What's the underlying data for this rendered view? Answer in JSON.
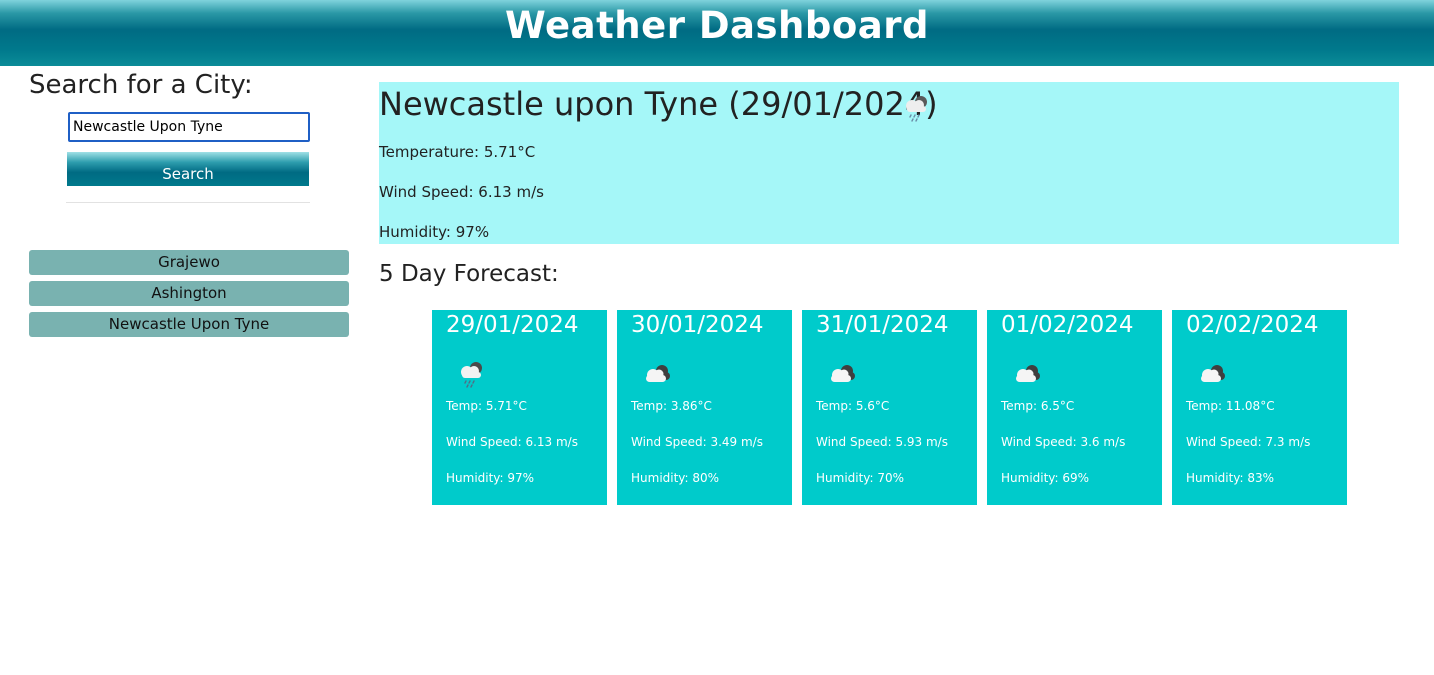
{
  "header": {
    "title": "Weather Dashboard"
  },
  "search": {
    "heading": "Search for a City:",
    "input_value": "Newcastle Upon Tyne",
    "button_label": "Search"
  },
  "history": [
    "Grajewo",
    "Ashington",
    "Newcastle Upon Tyne"
  ],
  "current": {
    "title": "Newcastle upon Tyne (29/01/2024)",
    "icon": "rain-cloud-icon",
    "temperature": "Temperature: 5.71°C",
    "wind": "Wind Speed: 6.13 m/s",
    "humidity": "Humidity: 97%"
  },
  "forecast_title": "5 Day Forecast:",
  "forecast": [
    {
      "date": "29/01/2024",
      "icon": "rain-cloud-icon",
      "temp": "Temp: 5.71°C",
      "wind": "Wind Speed: 6.13 m/s",
      "humidity": "Humidity: 97%"
    },
    {
      "date": "30/01/2024",
      "icon": "broken-clouds-icon",
      "temp": "Temp: 3.86°C",
      "wind": "Wind Speed: 3.49 m/s",
      "humidity": "Humidity: 80%"
    },
    {
      "date": "31/01/2024",
      "icon": "broken-clouds-icon",
      "temp": "Temp: 5.6°C",
      "wind": "Wind Speed: 5.93 m/s",
      "humidity": "Humidity: 70%"
    },
    {
      "date": "01/02/2024",
      "icon": "broken-clouds-icon",
      "temp": "Temp: 6.5°C",
      "wind": "Wind Speed: 3.6 m/s",
      "humidity": "Humidity: 69%"
    },
    {
      "date": "02/02/2024",
      "icon": "broken-clouds-icon",
      "temp": "Temp: 11.08°C",
      "wind": "Wind Speed: 7.3 m/s",
      "humidity": "Humidity: 83%"
    }
  ],
  "colors": {
    "header": "#006b83",
    "current_bg": "#a5f7f8",
    "card_bg": "#00cbcb",
    "history_button": "#79b2b0"
  }
}
